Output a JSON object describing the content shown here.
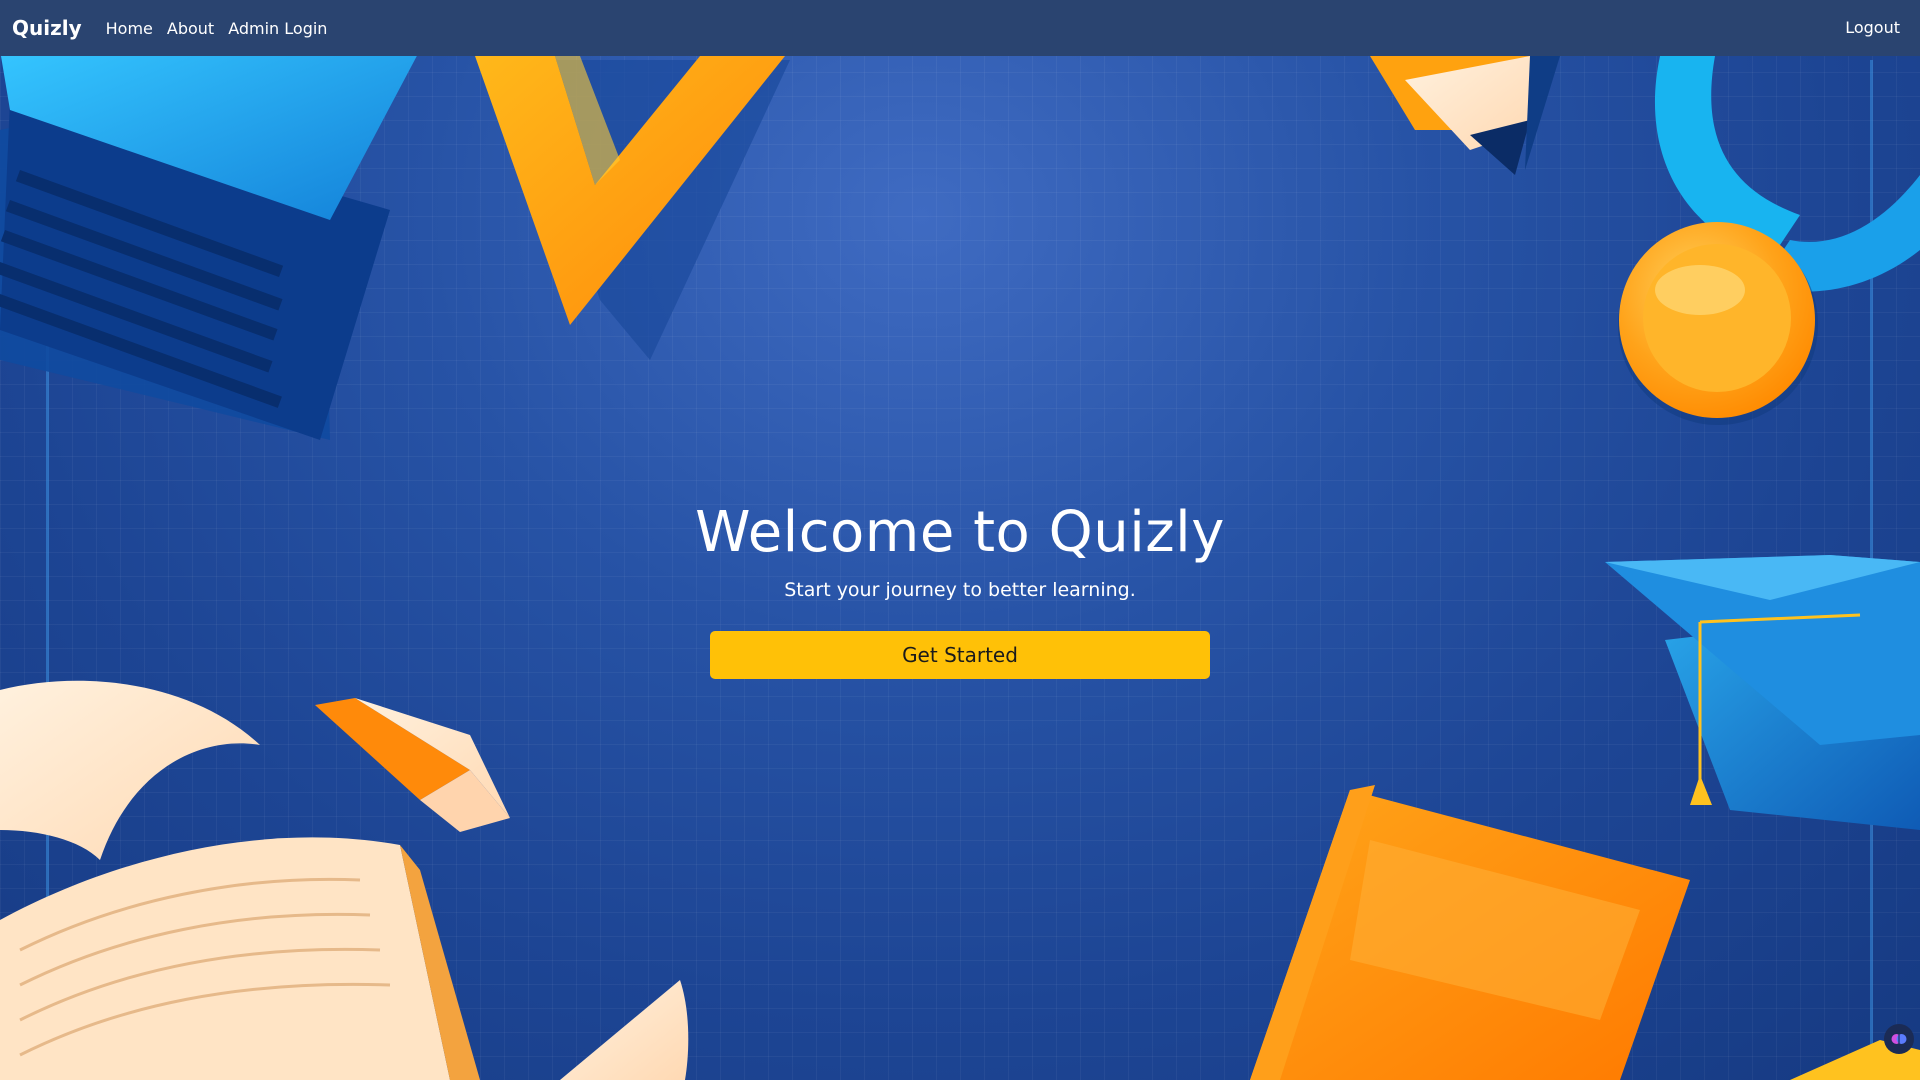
{
  "navbar": {
    "brand": "Quizly",
    "links": [
      {
        "label": "Home"
      },
      {
        "label": "About"
      },
      {
        "label": "Admin Login"
      }
    ],
    "logout": "Logout"
  },
  "hero": {
    "title": "Welcome to Quizly",
    "subtitle": "Start your journey to better learning.",
    "cta_label": "Get Started"
  },
  "colors": {
    "background": "#1d4594",
    "navbar": "#2a4470",
    "accent": "#ffc107",
    "illustration_orange": "#ff9a1a",
    "illustration_cyan": "#18b4f0"
  },
  "icons": {
    "corner_extension": "brain-icon"
  }
}
